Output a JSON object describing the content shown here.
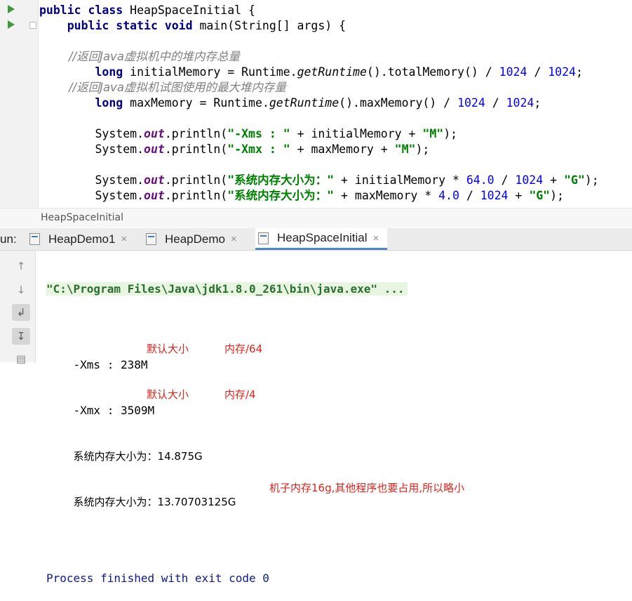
{
  "editor": {
    "lines": [
      [
        {
          "t": "public class ",
          "c": "kw"
        },
        {
          "t": "HeapSpaceInitial {",
          "c": ""
        }
      ],
      [
        {
          "t": "    public static void ",
          "c": "kw"
        },
        {
          "t": "main(String[] args) {",
          "c": ""
        }
      ],
      [],
      [
        {
          "t": "        //返回Java虚拟机中的堆内存总量",
          "c": "cm"
        }
      ],
      [
        {
          "t": "        long ",
          "c": "kw"
        },
        {
          "t": "initialMemory = Runtime.",
          "c": ""
        },
        {
          "t": "getRuntime",
          "c": "mth"
        },
        {
          "t": "().totalMemory() / ",
          "c": ""
        },
        {
          "t": "1024",
          "c": "num"
        },
        {
          "t": " / ",
          "c": ""
        },
        {
          "t": "1024",
          "c": "num"
        },
        {
          "t": ";",
          "c": ""
        }
      ],
      [
        {
          "t": "        //返回Java虚拟机试图使用的最大堆内存量",
          "c": "cm"
        }
      ],
      [
        {
          "t": "        long ",
          "c": "kw"
        },
        {
          "t": "maxMemory = Runtime.",
          "c": ""
        },
        {
          "t": "getRuntime",
          "c": "mth"
        },
        {
          "t": "().maxMemory() / ",
          "c": ""
        },
        {
          "t": "1024",
          "c": "num"
        },
        {
          "t": " / ",
          "c": ""
        },
        {
          "t": "1024",
          "c": "num"
        },
        {
          "t": ";",
          "c": ""
        }
      ],
      [],
      [
        {
          "t": "        System.",
          "c": ""
        },
        {
          "t": "out",
          "c": "fld"
        },
        {
          "t": ".println(",
          "c": ""
        },
        {
          "t": "\"-Xms : \"",
          "c": "str"
        },
        {
          "t": " + initialMemory + ",
          "c": ""
        },
        {
          "t": "\"M\"",
          "c": "str"
        },
        {
          "t": ");",
          "c": ""
        }
      ],
      [
        {
          "t": "        System.",
          "c": ""
        },
        {
          "t": "out",
          "c": "fld"
        },
        {
          "t": ".println(",
          "c": ""
        },
        {
          "t": "\"-Xmx : \"",
          "c": "str"
        },
        {
          "t": " + maxMemory + ",
          "c": ""
        },
        {
          "t": "\"M\"",
          "c": "str"
        },
        {
          "t": ");",
          "c": ""
        }
      ],
      [],
      [
        {
          "t": "        System.",
          "c": ""
        },
        {
          "t": "out",
          "c": "fld"
        },
        {
          "t": ".println(",
          "c": ""
        },
        {
          "t": "\"系统内存大小为：\"",
          "c": "str"
        },
        {
          "t": " + initialMemory * ",
          "c": ""
        },
        {
          "t": "64.0",
          "c": "num"
        },
        {
          "t": " / ",
          "c": ""
        },
        {
          "t": "1024",
          "c": "num"
        },
        {
          "t": " + ",
          "c": ""
        },
        {
          "t": "\"G\"",
          "c": "str"
        },
        {
          "t": ");",
          "c": ""
        }
      ],
      [
        {
          "t": "        System.",
          "c": ""
        },
        {
          "t": "out",
          "c": "fld"
        },
        {
          "t": ".println(",
          "c": ""
        },
        {
          "t": "\"系统内存大小为：\"",
          "c": "str"
        },
        {
          "t": " + maxMemory * ",
          "c": ""
        },
        {
          "t": "4.0",
          "c": "num"
        },
        {
          "t": " / ",
          "c": ""
        },
        {
          "t": "1024",
          "c": "num"
        },
        {
          "t": " + ",
          "c": ""
        },
        {
          "t": "\"G\"",
          "c": "str"
        },
        {
          "t": ");",
          "c": ""
        }
      ]
    ]
  },
  "breadcrumb": {
    "label": "HeapSpaceInitial"
  },
  "run_panel": {
    "label": "un:",
    "tabs": [
      {
        "label": "HeapDemo1"
      },
      {
        "label": "HeapDemo"
      },
      {
        "label": "HeapSpaceInitial",
        "active": true
      }
    ],
    "close_glyph": "×"
  },
  "console": {
    "command": "\"C:\\Program Files\\Java\\jdk1.8.0_261\\bin\\java.exe\" ...",
    "output": [
      {
        "text": "-Xms : 238M",
        "note1": "默认大小",
        "note2": "内存/64"
      },
      {
        "text": "-Xmx : 3509M",
        "note1": "默认大小",
        "note2": "内存/4"
      },
      {
        "text": "系统内存大小为：14.875G"
      },
      {
        "text": "系统内存大小为：13.70703125G",
        "note1": "机子内存16g,其他程序也要占用,所以略小"
      }
    ],
    "exit": "Process finished with exit code 0"
  },
  "colors": {
    "annotation": "#e0231c",
    "keyword": "#000080",
    "string": "#008000",
    "number": "#0000ff",
    "comment": "#808080"
  },
  "icons": [
    "run-icon",
    "fold-icon",
    "java-file-icon",
    "close-icon",
    "arrow-up-icon",
    "arrow-down-icon",
    "soft-wrap-icon",
    "scroll-to-end-icon"
  ]
}
